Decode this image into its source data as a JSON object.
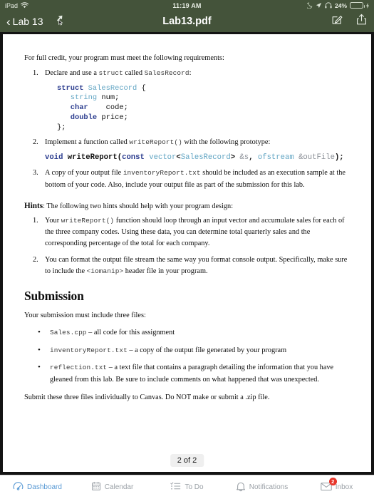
{
  "statusbar": {
    "device": "iPad",
    "wifi_icon": "wifi-icon",
    "time": "11:19 AM",
    "moon_icon": "crescent-moon-icon",
    "location_icon": "location-arrow-icon",
    "headphones_icon": "headphones-icon",
    "battery_percent": "24%",
    "battery_level": 24,
    "charging_icon": "lightning-bolt-icon"
  },
  "navbar": {
    "back_label": "Lab 13",
    "back_chevron": "chevron-left-icon",
    "title": "Lab13.pdf",
    "markup_icon": "markup-pencil-icon",
    "share_icon": "share-square-icon",
    "cursor_icon": "pointer-arrow-icon",
    "bg_color": "#44533a"
  },
  "document": {
    "intro": "For full credit, your program must meet the following requirements:",
    "requirements": [
      {
        "text_before": "Declare and use a ",
        "code1": "struct",
        "text_mid": " called ",
        "code2": "SalesRecord",
        "text_after": ":"
      },
      {
        "text_before": "Implement a function called ",
        "code1": "writeReport()",
        "text_mid": " with the following prototype:",
        "code2": "",
        "text_after": ""
      },
      {
        "text_before": "A copy of your output file ",
        "code1": "inventoryReport.txt",
        "text_mid": " should be included as an execution sample at the bottom of your code. Also, include your output file as part of the submission for this lab.",
        "code2": "",
        "text_after": ""
      }
    ],
    "struct_code": {
      "line1_kw": "struct",
      "line1_type": "SalesRecord",
      "line1_brace": "{",
      "line2_kw": "string",
      "line2_id": "num;",
      "line3_kw": "char",
      "line3_id": "code;",
      "line4_kw": "double",
      "line4_id": "price;",
      "line5": "};"
    },
    "prototype": {
      "void": "void",
      "fname": " writeReport(",
      "const": "const",
      "vector": " vector",
      "lt": "<",
      "salesrecord": "SalesRecord",
      "gt": "> ",
      "amp_s": "&s",
      "comma": ", ",
      "ofstream": "ofstream",
      "amp_outfile": " &outFile",
      "end": ");"
    },
    "hints_label": "Hints",
    "hints_intro": ": The following two hints should help with your program design:",
    "hints": [
      {
        "text_before": "Your ",
        "code": "writeReport()",
        "text_after": " function should loop through an input vector and accumulate sales for each of the three company codes. Using these data, you can determine total quarterly sales and the corresponding percentage of the total for each company."
      },
      {
        "text_before": "You can format the output file stream the same way you format console output. Specifically, make sure to include the ",
        "code": "<iomanip>",
        "text_after": " header file in your program."
      }
    ],
    "submission_heading": "Submission",
    "submission_intro": "Your submission must include three files:",
    "files": [
      {
        "name": "Sales.cpp",
        "desc": " –  all code for this assignment"
      },
      {
        "name": "inventoryReport.txt",
        "desc": " – a copy of the output file generated by your program"
      },
      {
        "name": "reflection.txt",
        "desc": " –  a text file that contains a paragraph detailing the information that you have gleaned from this lab. Be sure to include comments on what happened that was unexpected."
      }
    ],
    "closing": "Submit these three files individually to Canvas. Do NOT make or submit a .zip file.",
    "page_indicator": "2 of 2"
  },
  "tabbar": {
    "active_color": "#5b9bd5",
    "inactive_color": "#9aa0a6",
    "badge_color": "#e8362b",
    "items": [
      {
        "label": "Dashboard",
        "icon": "dashboard-gauge-icon",
        "active": true,
        "badge": ""
      },
      {
        "label": "Calendar",
        "icon": "calendar-icon",
        "active": false,
        "badge": ""
      },
      {
        "label": "To Do",
        "icon": "checklist-icon",
        "active": false,
        "badge": ""
      },
      {
        "label": "Notifications",
        "icon": "bell-icon",
        "active": false,
        "badge": ""
      },
      {
        "label": "Inbox",
        "icon": "envelope-icon",
        "active": false,
        "badge": "2"
      }
    ]
  }
}
